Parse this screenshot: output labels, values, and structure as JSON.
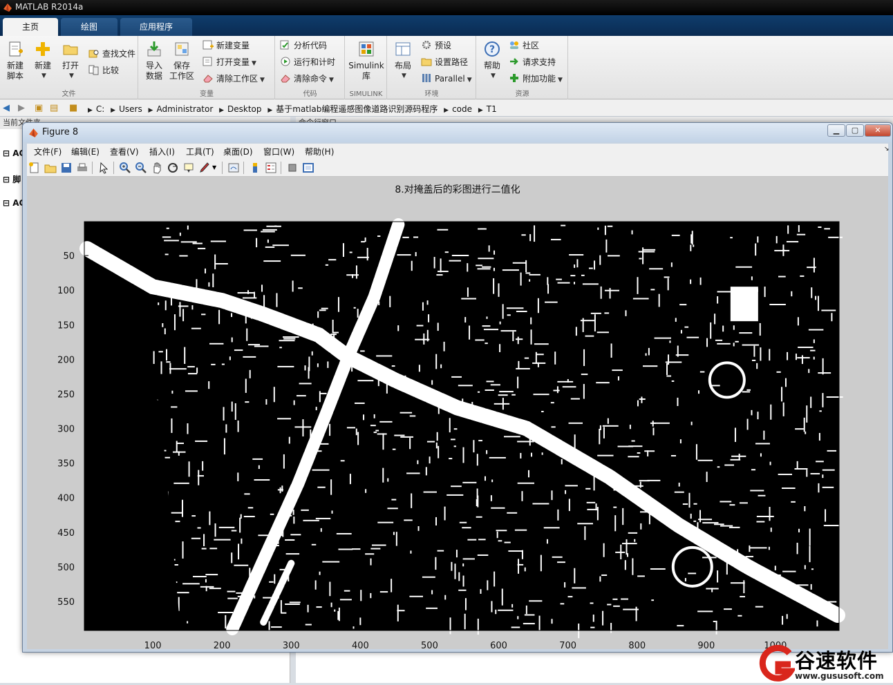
{
  "app": {
    "title": "MATLAB R2014a"
  },
  "ribbon": {
    "tabs": [
      "主页",
      "绘图",
      "应用程序"
    ],
    "groups": {
      "file": {
        "label": "文件",
        "new_script": "新建\n脚本",
        "new": "新建",
        "open": "打开",
        "find_files": "查找文件",
        "compare": "比较"
      },
      "variable": {
        "label": "变量",
        "import": "导入\n数据",
        "save": "保存\n工作区",
        "new_var": "新建变量",
        "open_var": "打开变量",
        "clear_ws": "清除工作区"
      },
      "code": {
        "label": "代码",
        "analyze": "分析代码",
        "run_time": "运行和计时",
        "clear_cmd": "清除命令"
      },
      "simulink": {
        "label": "SIMULINK",
        "lib": "Simulink\n库"
      },
      "environment": {
        "label": "环境",
        "layout": "布局",
        "prefs": "预设",
        "set_path": "设置路径",
        "parallel": "Parallel"
      },
      "resources": {
        "label": "资源",
        "help": "帮助",
        "community": "社区",
        "support": "请求支持",
        "addons": "附加功能"
      }
    }
  },
  "address": {
    "crumbs": [
      "C:",
      "Users",
      "Administrator",
      "Desktop",
      "基于matlab编程遥感图像道路识别源码程序",
      "code",
      "T1"
    ]
  },
  "panels": {
    "left_header": "当前文件夹",
    "left_items": [
      "AC",
      "脚",
      "AC"
    ],
    "right_header": "命令行窗口"
  },
  "figure": {
    "title": "Figure 8",
    "menus": [
      "文件(F)",
      "编辑(E)",
      "查看(V)",
      "插入(I)",
      "工具(T)",
      "桌面(D)",
      "窗口(W)",
      "帮助(H)"
    ],
    "plot_title": "8.对掩盖后的彩图进行二值化",
    "x_ticks": [
      100,
      200,
      300,
      400,
      500,
      600,
      700,
      800,
      900,
      1000
    ],
    "y_ticks": [
      50,
      100,
      150,
      200,
      250,
      300,
      350,
      400,
      450,
      500,
      550
    ],
    "x_range": [
      1,
      1092
    ],
    "y_range": [
      1,
      592
    ],
    "colors": {
      "background": "#000000",
      "foreground": "#ffffff"
    }
  },
  "watermark": {
    "text": "谷速软件",
    "url": "www.gususoft.com",
    "color": "#d9261c"
  }
}
